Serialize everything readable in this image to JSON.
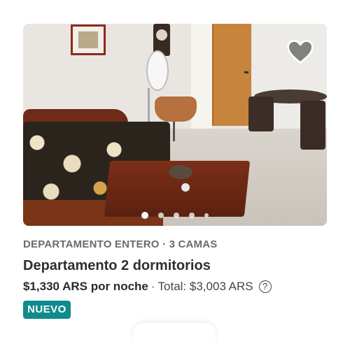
{
  "listing": {
    "meta": "DEPARTAMENTO ENTERO · 3 CAMAS",
    "title": "Departamento 2 dormitorios",
    "price_strong": "$1,330 ARS por noche",
    "separator": "·",
    "total": "Total: $3,003 ARS",
    "info_icon_glyph": "?",
    "badge": "NUEVO",
    "badge_color": "#0f8b8d"
  },
  "photo": {
    "carousel_total": 5,
    "carousel_active": 1,
    "favorite_icon": "heart-icon"
  }
}
